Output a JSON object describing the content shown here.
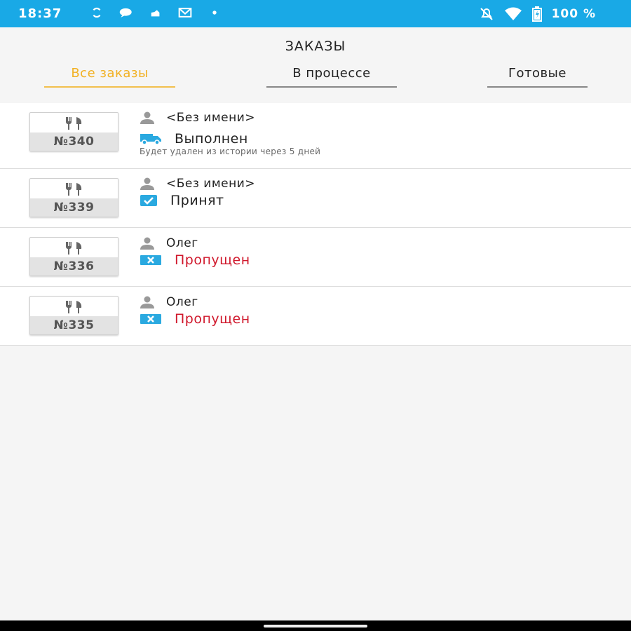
{
  "status_bar": {
    "time": "18:37",
    "battery": "100 %",
    "icons_left": [
      "sync-icon",
      "chat-icon",
      "cloud-icon",
      "mail-icon",
      "dot-icon"
    ],
    "icons_right": [
      "mute-icon",
      "wifi-icon",
      "battery-icon"
    ]
  },
  "header": {
    "title": "ЗАКАЗЫ",
    "tabs": [
      {
        "label": "Все заказы",
        "active": true
      },
      {
        "label": "В процессе",
        "active": false
      },
      {
        "label": "Готовые",
        "active": false
      }
    ]
  },
  "orders": [
    {
      "number": "№340",
      "customer": "<Без имени>",
      "status": "Выполнен",
      "status_icon": "truck-icon",
      "note": "Будет удален из истории через 5 дней"
    },
    {
      "number": "№339",
      "customer": "<Без имени>",
      "status": "Принят",
      "status_icon": "checkbox-icon",
      "note": ""
    },
    {
      "number": "№336",
      "customer": "Олег",
      "status": "Пропущен",
      "status_icon": "cross-icon",
      "note": ""
    },
    {
      "number": "№335",
      "customer": "Олег",
      "status": "Пропущен",
      "status_icon": "cross-icon",
      "note": ""
    }
  ],
  "colors": {
    "status_bar": "#19a9e6",
    "active_tab": "#f2b123",
    "skipped": "#d0182c",
    "icon_blue": "#2aa9e0"
  }
}
